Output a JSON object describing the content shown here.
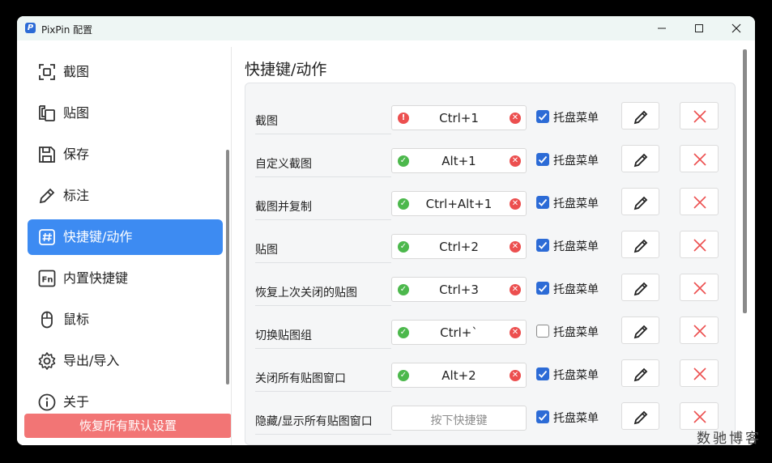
{
  "window": {
    "title": "PixPin 配置",
    "logo_letter": "P"
  },
  "sidebar": {
    "items": [
      {
        "label": "截图",
        "icon": "screenshot-icon"
      },
      {
        "label": "贴图",
        "icon": "pin-icon"
      },
      {
        "label": "保存",
        "icon": "save-icon"
      },
      {
        "label": "标注",
        "icon": "pencil-icon"
      },
      {
        "label": "快捷键/动作",
        "icon": "hashtag-icon",
        "active": true
      },
      {
        "label": "内置快捷键",
        "icon": "fn-key-icon"
      },
      {
        "label": "鼠标",
        "icon": "mouse-icon"
      },
      {
        "label": "导出/导入",
        "icon": "gear-icon"
      },
      {
        "label": "关于",
        "icon": "info-icon"
      }
    ],
    "reset_label": "恢复所有默认设置"
  },
  "main": {
    "title": "快捷键/动作",
    "tray_label": "托盘菜单",
    "hotkeys": [
      {
        "action": "截图",
        "shortcut": "Ctrl+1",
        "status": "error",
        "tray_menu": true
      },
      {
        "action": "自定义截图",
        "shortcut": "Alt+1",
        "status": "ok",
        "tray_menu": true
      },
      {
        "action": "截图并复制",
        "shortcut": "Ctrl+Alt+1",
        "status": "ok",
        "tray_menu": true
      },
      {
        "action": "贴图",
        "shortcut": "Ctrl+2",
        "status": "ok",
        "tray_menu": true
      },
      {
        "action": "恢复上次关闭的贴图",
        "shortcut": "Ctrl+3",
        "status": "ok",
        "tray_menu": true
      },
      {
        "action": "切换贴图组",
        "shortcut": "Ctrl+`",
        "status": "ok",
        "tray_menu": false
      },
      {
        "action": "关闭所有贴图窗口",
        "shortcut": "Alt+2",
        "status": "ok",
        "tray_menu": true
      },
      {
        "action": "隐藏/显示所有贴图窗口",
        "shortcut": "",
        "placeholder": "按下快捷键",
        "status": "none",
        "tray_menu": true
      }
    ]
  },
  "watermark": "数驰博客",
  "colors": {
    "accent": "#3d8bf2",
    "checkbox": "#2c6bd6",
    "danger": "#ec4f4f",
    "reset": "#f27575",
    "ok": "#4cb84c"
  }
}
